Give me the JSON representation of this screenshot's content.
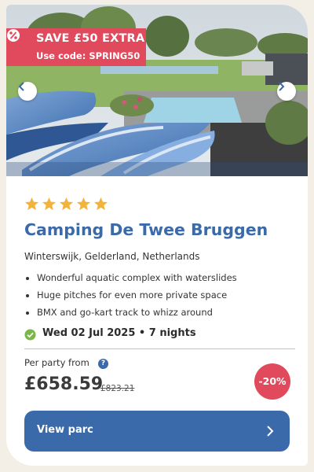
{
  "promo": {
    "title": "SAVE £50 EXTRA",
    "code": "Use code: SPRING50",
    "icon": "percent-badge-icon"
  },
  "gallery": {
    "prev_icon": "chevron-left-icon",
    "next_icon": "chevron-right-icon"
  },
  "listing": {
    "rating_stars": 5,
    "title": "Camping De Twee Bruggen",
    "location": "Winterswijk, Gelderland, Netherlands",
    "features": [
      "Wonderful aquatic complex with waterslides",
      "Huge pitches for even more private space",
      "BMX and go-kart track to whizz around"
    ],
    "date": "Wed 02 Jul 2025 • 7 nights"
  },
  "pricing": {
    "label": "Per party from",
    "price": "£658.59",
    "old_price": "£823.21",
    "discount": "-20%"
  },
  "cta": {
    "label": "View parc"
  },
  "colors": {
    "brand_blue": "#3a6aaa",
    "promo_red": "#e04a5c",
    "star_gold": "#f2b33d",
    "check_green": "#7ab648"
  }
}
